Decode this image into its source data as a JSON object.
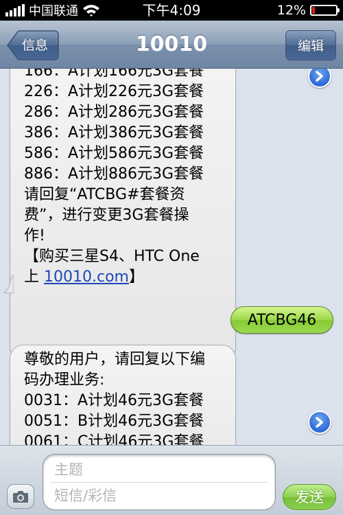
{
  "status_bar": {
    "carrier": "中国联通",
    "time": "下午4:09",
    "battery_percent": "12%",
    "battery_level": 0.12,
    "battery_color": "#e3201b"
  },
  "nav": {
    "back_label": "信息",
    "title": "10010",
    "edit_label": "编辑"
  },
  "messages": {
    "incoming_1": [
      "166：A计划166元3G套餐",
      "226：A计划226元3G套餐",
      "286：A计划286元3G套餐",
      "386：A计划386元3G套餐",
      "586：A计划586元3G套餐",
      "886：A计划886元3G套餐",
      "请回复“ATCBG#套餐资",
      "费”，进行变更3G套餐操",
      "作!",
      "【购买三星S4、HTC One",
      "上 "
    ],
    "incoming_1_link": "10010.com",
    "incoming_1_end": "】",
    "outgoing": "ATCBG46",
    "incoming_2": [
      "尊敬的用户，请回复以下编",
      "码办理业务:",
      "0031：A计划46元3G套餐",
      "0051：B计划46元3G套餐",
      "0061：C计划46元3G套餐"
    ]
  },
  "icons": {
    "detail_arrow": "chevron-right-circle-icon",
    "camera": "camera-icon",
    "signal": "signal-bars-icon",
    "wifi": "wifi-icon",
    "battery": "battery-icon"
  },
  "composer": {
    "subject_placeholder": "主题",
    "body_placeholder": "短信/彩信",
    "send_label": "发送"
  }
}
